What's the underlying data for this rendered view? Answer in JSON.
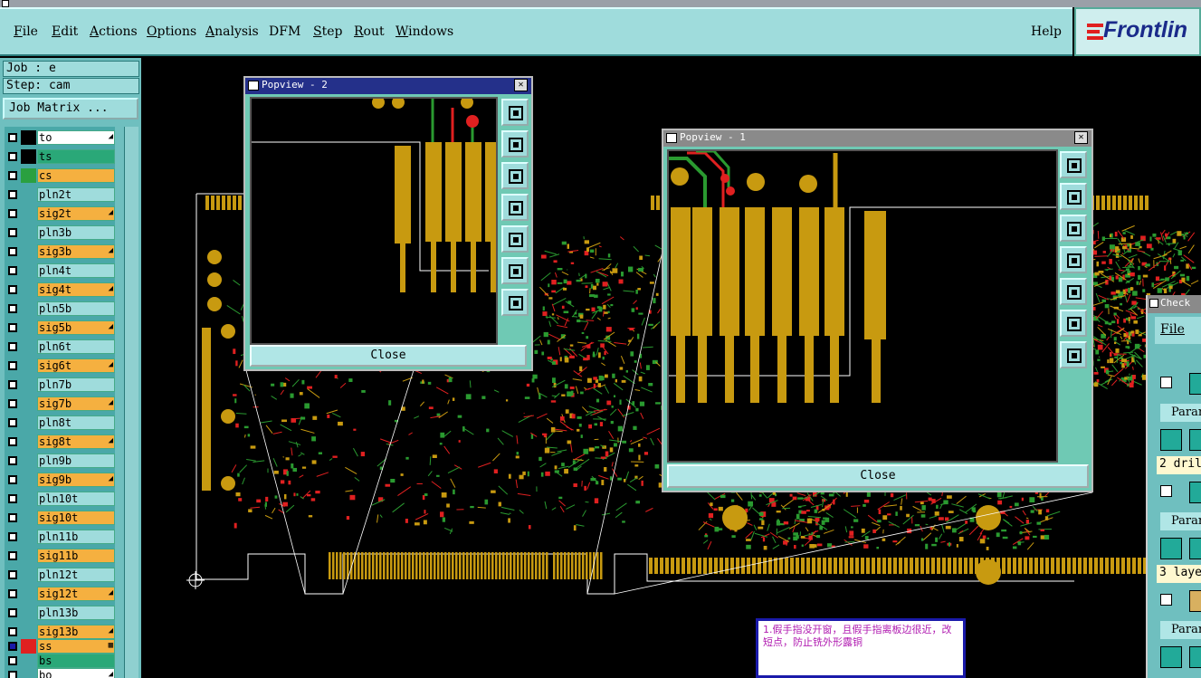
{
  "menu": {
    "items": [
      "File",
      "Edit",
      "Actions",
      "Options",
      "Analysis",
      "DFM",
      "Step",
      "Rout",
      "Windows"
    ],
    "help": "Help",
    "logo_text": "Frontlin"
  },
  "info": {
    "job": "Job : e",
    "step": "Step: cam",
    "job_matrix": "Job Matrix ..."
  },
  "layers": [
    {
      "name": "to",
      "color": "#ffffff",
      "swatch": "#000000",
      "mark": "◢"
    },
    {
      "name": "ts",
      "color": "#2aa878",
      "swatch": "#000000",
      "mark": ""
    },
    {
      "name": "cs",
      "color": "#f5b040",
      "swatch": "#2aa040",
      "mark": ""
    },
    {
      "name": "pln2t",
      "color": "#9fdcdc",
      "swatch": "#4aa8a8",
      "mark": ""
    },
    {
      "name": "sig2t",
      "color": "#f5b040",
      "swatch": "#4aa8a8",
      "mark": "◢"
    },
    {
      "name": "pln3b",
      "color": "#9fdcdc",
      "swatch": "#4aa8a8",
      "mark": ""
    },
    {
      "name": "sig3b",
      "color": "#f5b040",
      "swatch": "#4aa8a8",
      "mark": "◢"
    },
    {
      "name": "pln4t",
      "color": "#9fdcdc",
      "swatch": "#4aa8a8",
      "mark": ""
    },
    {
      "name": "sig4t",
      "color": "#f5b040",
      "swatch": "#4aa8a8",
      "mark": "◢"
    },
    {
      "name": "pln5b",
      "color": "#9fdcdc",
      "swatch": "#4aa8a8",
      "mark": ""
    },
    {
      "name": "sig5b",
      "color": "#f5b040",
      "swatch": "#4aa8a8",
      "mark": "◢"
    },
    {
      "name": "pln6t",
      "color": "#9fdcdc",
      "swatch": "#4aa8a8",
      "mark": ""
    },
    {
      "name": "sig6t",
      "color": "#f5b040",
      "swatch": "#4aa8a8",
      "mark": "◢"
    },
    {
      "name": "pln7b",
      "color": "#9fdcdc",
      "swatch": "#4aa8a8",
      "mark": ""
    },
    {
      "name": "sig7b",
      "color": "#f5b040",
      "swatch": "#4aa8a8",
      "mark": "◢"
    },
    {
      "name": "pln8t",
      "color": "#9fdcdc",
      "swatch": "#4aa8a8",
      "mark": ""
    },
    {
      "name": "sig8t",
      "color": "#f5b040",
      "swatch": "#4aa8a8",
      "mark": "◢"
    },
    {
      "name": "pln9b",
      "color": "#9fdcdc",
      "swatch": "#4aa8a8",
      "mark": ""
    },
    {
      "name": "sig9b",
      "color": "#f5b040",
      "swatch": "#4aa8a8",
      "mark": "◢"
    },
    {
      "name": "pln10t",
      "color": "#9fdcdc",
      "swatch": "#4aa8a8",
      "mark": ""
    },
    {
      "name": "sig10t",
      "color": "#f5b040",
      "swatch": "#4aa8a8",
      "mark": ""
    },
    {
      "name": "pln11b",
      "color": "#9fdcdc",
      "swatch": "#4aa8a8",
      "mark": ""
    },
    {
      "name": "sig11b",
      "color": "#f5b040",
      "swatch": "#4aa8a8",
      "mark": ""
    },
    {
      "name": "pln12t",
      "color": "#9fdcdc",
      "swatch": "#4aa8a8",
      "mark": ""
    },
    {
      "name": "sig12t",
      "color": "#f5b040",
      "swatch": "#4aa8a8",
      "mark": "◢"
    },
    {
      "name": "pln13b",
      "color": "#9fdcdc",
      "swatch": "#4aa8a8",
      "mark": ""
    },
    {
      "name": "sig13b",
      "color": "#f5b040",
      "swatch": "#4aa8a8",
      "mark": "◢"
    },
    {
      "name": "ss",
      "color": "#f5b040",
      "swatch": "#e02020",
      "mark": "▦"
    },
    {
      "name": "bs",
      "color": "#2aa878",
      "swatch": "#4aa8a8",
      "mark": ""
    },
    {
      "name": "bo",
      "color": "#ffffff",
      "swatch": "#4aa8a8",
      "mark": "◢"
    }
  ],
  "popview2": {
    "title": "Popview - 2",
    "close": "Close",
    "close_x": "✕"
  },
  "popview1": {
    "title": "Popview - 1",
    "close": "Close",
    "close_x": "✕"
  },
  "checklist": {
    "title": "Check",
    "file": "File",
    "param": "Param",
    "lines": [
      "2 dril",
      "3 laye"
    ]
  },
  "note": {
    "text": "1.假手指没开窗，且假手指离板边很近，改短点，防止铣外形露铜"
  },
  "colors": {
    "menu_bg": "#9fdcdc",
    "panel_bg": "#6fbfbf",
    "copper": "#c89a10",
    "signal_green": "#2a9a30",
    "signal_red": "#e02020",
    "popup_title_active": "#24308a",
    "popup_title_inactive": "#8a8a8a"
  }
}
